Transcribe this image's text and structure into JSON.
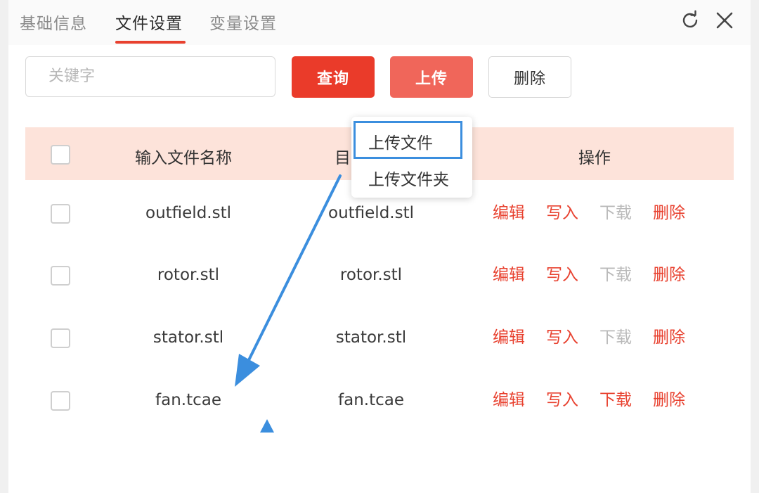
{
  "tabs": [
    {
      "label": "基础信息"
    },
    {
      "label": "文件设置"
    },
    {
      "label": "变量设置"
    }
  ],
  "header_icons": [
    "refresh-icon",
    "close-icon"
  ],
  "toolbar": {
    "search_placeholder": "关键字",
    "query_label": "查询",
    "upload_label": "上传",
    "delete_label": "删除"
  },
  "upload_menu": {
    "items": [
      "上传文件",
      "上传文件夹"
    ]
  },
  "table": {
    "headers": [
      "输入文件名称",
      "目",
      "操作"
    ],
    "rows": [
      {
        "name": "outfield.stl",
        "target": "outfield.stl",
        "ops": [
          "编辑",
          "写入",
          "下载",
          "删除"
        ],
        "download_enabled": false
      },
      {
        "name": "rotor.stl",
        "target": "rotor.stl",
        "ops": [
          "编辑",
          "写入",
          "下载",
          "删除"
        ],
        "download_enabled": false
      },
      {
        "name": "stator.stl",
        "target": "stator.stl",
        "ops": [
          "编辑",
          "写入",
          "下载",
          "删除"
        ],
        "download_enabled": false
      },
      {
        "name": "fan.tcae",
        "target": "fan.tcae",
        "ops": [
          "编辑",
          "写入",
          "下载",
          "删除"
        ],
        "download_enabled": true
      }
    ]
  },
  "colors": {
    "accent": "#e8412f",
    "upload_button": "#f0665a",
    "header_row": "#fde3da",
    "annotation": "#3b8ede",
    "disabled": "#b9b9b9"
  }
}
